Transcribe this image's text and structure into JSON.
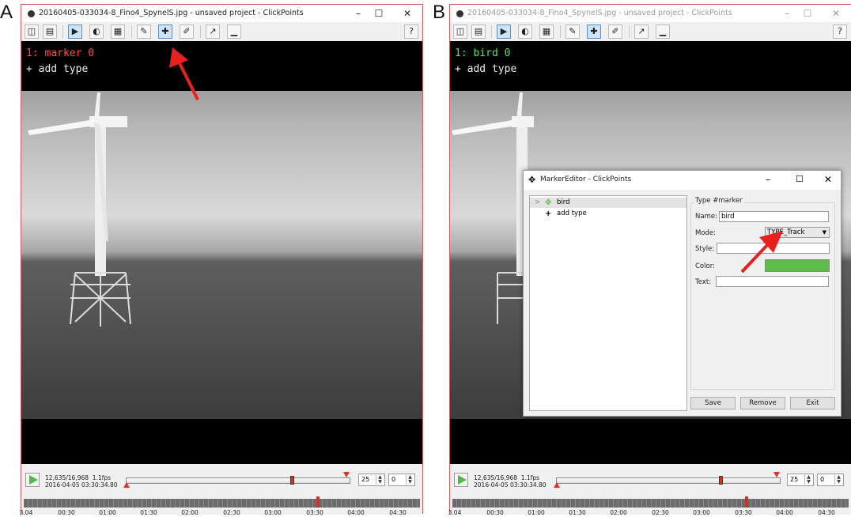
{
  "panels": [
    {
      "letter": "A",
      "window_title": "20160405-033034-8_Fino4_SpynelS.jpg - unsaved project - ClickPoints",
      "overlay": {
        "line1": "1: marker 0",
        "line1_color": "#ff4a4a",
        "line2": "+ add type"
      },
      "frame": {
        "counter": "12,635/16,968",
        "fps": "1.1fps",
        "timestamp": "2016-04-05 03:30:34.80"
      },
      "spin_fps": "25",
      "spin_skip": "0"
    },
    {
      "letter": "B",
      "window_title": "20160405-033034-8_Fino4_SpynelS.jpg - unsaved project - ClickPoints",
      "overlay": {
        "line1": "1: bird 0",
        "line1_color": "#59e659",
        "line2": "+ add type"
      },
      "frame": {
        "counter": "12,635/16,968",
        "fps": "1.1fps",
        "timestamp": "2016-04-05 03:30:34.80"
      },
      "spin_fps": "25",
      "spin_skip": "0"
    }
  ],
  "timeline_ticks": [
    "3.04",
    "00:30",
    "01:00",
    "01:30",
    "02:00",
    "02:30",
    "03:00",
    "03:30",
    "04:00",
    "04:30"
  ],
  "toolbar_icons": [
    "save-icon",
    "open-folder-icon",
    "play-icon",
    "contrast-icon",
    "film-icon",
    "annotation-icon",
    "marker-icon",
    "paint-brush-icon",
    "export-icon",
    "chart-icon",
    "help-icon"
  ],
  "help_label": "?",
  "marker_editor": {
    "title": "MarkerEditor - ClickPoints",
    "tree": [
      {
        "label": "bird",
        "expander": ">"
      },
      {
        "label": "add type"
      }
    ],
    "group_title": "Type #marker",
    "name_label": "Name:",
    "name_value": "bird",
    "mode_label": "Mode:",
    "mode_value": "TYPE_Track",
    "style_label": "Style:",
    "style_value": "",
    "color_label": "Color:",
    "color_value": "#5bbd45",
    "text_label": "Text:",
    "text_value": "",
    "buttons": {
      "save": "Save",
      "remove": "Remove",
      "exit": "Exit"
    }
  },
  "colors": {
    "arrow": "#e8211f",
    "window_border": "#d65a5a",
    "play": "#53b84a"
  }
}
